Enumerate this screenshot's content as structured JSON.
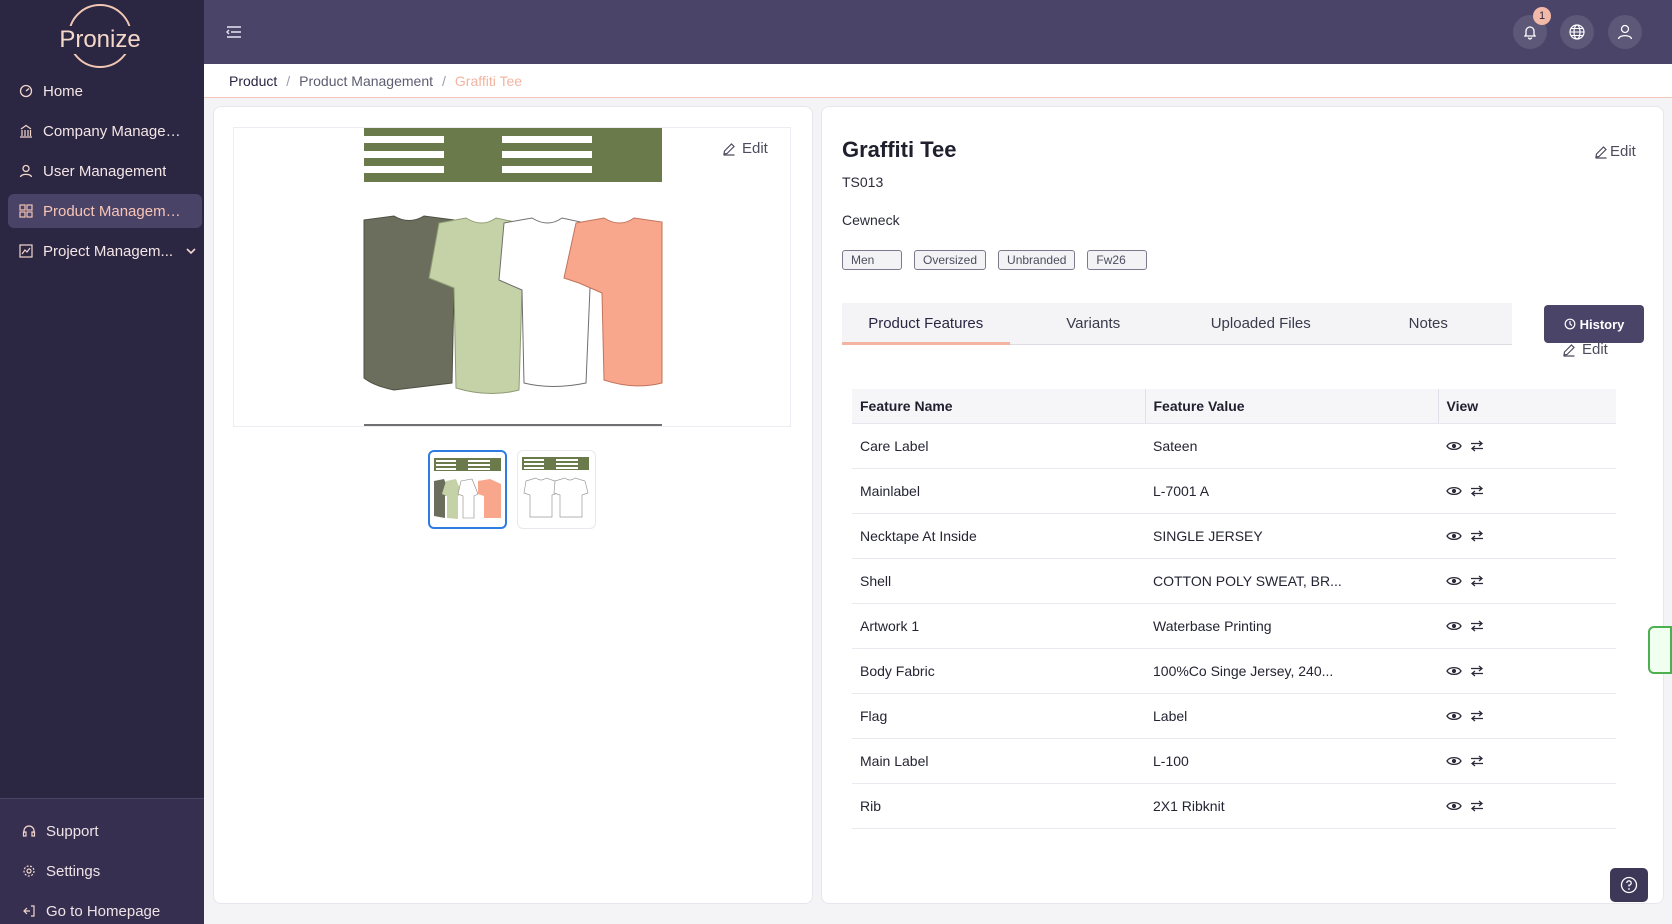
{
  "brand": {
    "name": "Pronize"
  },
  "sidebar": {
    "items": [
      {
        "label": "Home",
        "icon": "dashboard-icon"
      },
      {
        "label": "Company Managem...",
        "icon": "building-icon"
      },
      {
        "label": "User Management",
        "icon": "user-icon"
      },
      {
        "label": "Product Management",
        "icon": "grid-icon"
      },
      {
        "label": "Project Managem...",
        "icon": "project-icon"
      }
    ],
    "footer": [
      {
        "label": "Support",
        "icon": "headset-icon"
      },
      {
        "label": "Settings",
        "icon": "gear-icon"
      },
      {
        "label": "Go to Homepage",
        "icon": "exit-icon"
      }
    ]
  },
  "topbar": {
    "notification_count": "1"
  },
  "breadcrumb": {
    "items": [
      "Product",
      "Product Management",
      "Graffiti Tee"
    ]
  },
  "gallery": {
    "edit_label": "Edit"
  },
  "product": {
    "title": "Graffiti Tee",
    "code": "TS013",
    "neck": "Cewneck",
    "edit_label": "Edit",
    "tags": [
      "Men",
      "Oversized",
      "Unbranded",
      "Fw26"
    ]
  },
  "tabs": [
    "Product Features",
    "Variants",
    "Uploaded Files",
    "Notes"
  ],
  "history_label": "History",
  "features": {
    "edit_label": "Edit",
    "headers": [
      "Feature Name",
      "Feature Value",
      "View"
    ],
    "rows": [
      {
        "name": "Care Label",
        "value": "Sateen"
      },
      {
        "name": "Mainlabel",
        "value": "L-7001 A"
      },
      {
        "name": "Necktape At Inside",
        "value": "SINGLE JERSEY"
      },
      {
        "name": "Shell",
        "value": "COTTON POLY SWEAT, BR..."
      },
      {
        "name": "Artwork 1",
        "value": "Waterbase Printing"
      },
      {
        "name": "Body Fabric",
        "value": "100%Co Singe Jersey, 240..."
      },
      {
        "name": "Flag",
        "value": "Label"
      },
      {
        "name": "Main Label",
        "value": "L-100"
      },
      {
        "name": "Rib",
        "value": "2X1 Ribknit"
      }
    ]
  },
  "colors": {
    "sidebar": "#2b2642",
    "topbar": "#4a4468",
    "accent": "#f3b4a2",
    "tshirts": [
      "#6b6e5c",
      "#c5d2a8",
      "#ffffff",
      "#f8a68c"
    ]
  }
}
